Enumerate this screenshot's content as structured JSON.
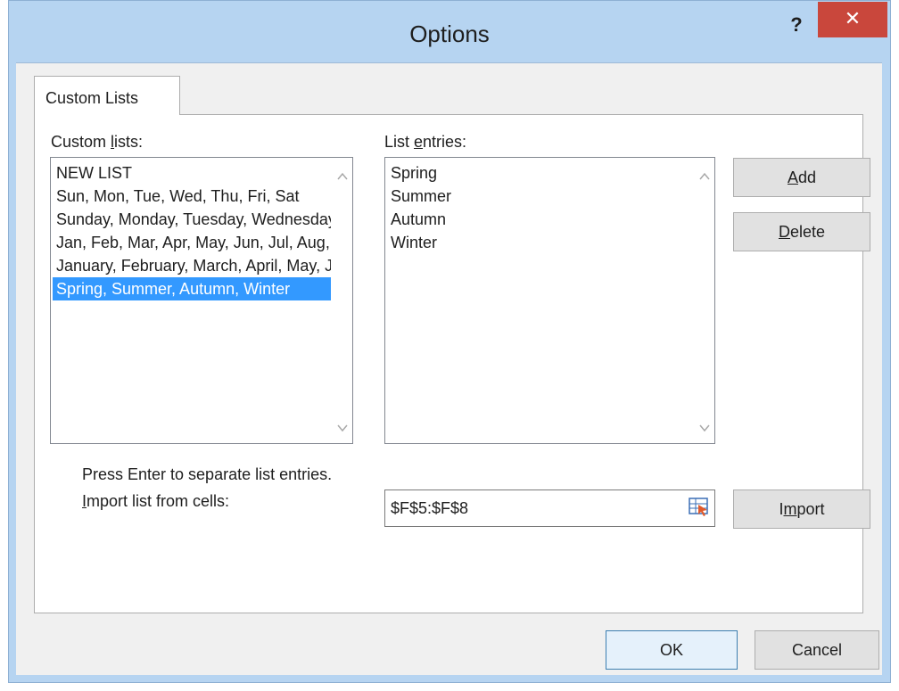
{
  "window": {
    "title": "Options",
    "help_label": "?",
    "close_label": "✕"
  },
  "tabs": [
    {
      "label": "Custom Lists"
    }
  ],
  "custom_lists": {
    "label_pre": "Custom ",
    "label_key": "l",
    "label_post": "ists:",
    "items": [
      "NEW LIST",
      "Sun, Mon, Tue, Wed, Thu, Fri, Sat",
      "Sunday, Monday, Tuesday, Wednesday, Thursday, Friday, Saturday",
      "Jan, Feb, Mar, Apr, May, Jun, Jul, Aug, Sep, Oct, Nov, Dec",
      "January, February, March, April, May, June, July, August, September, October, November, December",
      "Spring, Summer, Autumn, Winter"
    ],
    "selected_index": 5
  },
  "list_entries": {
    "label_pre": "List ",
    "label_key": "e",
    "label_post": "ntries:",
    "items": [
      "Spring",
      "Summer",
      "Autumn",
      "Winter"
    ]
  },
  "buttons": {
    "add_key": "A",
    "add_rest": "dd",
    "delete_key": "D",
    "delete_rest": "elete",
    "import_pre": "I",
    "import_key": "m",
    "import_post": "port",
    "ok": "OK",
    "cancel": "Cancel"
  },
  "hint": "Press Enter to separate list entries.",
  "import_from": {
    "label_key": "I",
    "label_rest": "mport list from cells:",
    "value": "$F$5:$F$8"
  },
  "colors": {
    "selection": "#3399ff",
    "close": "#c9473c",
    "frame": "#b6d4f1"
  },
  "icons": {
    "collapse_dialog": "collapse-dialog-icon",
    "scroll_up": "chevron-up-icon",
    "scroll_down": "chevron-down-icon"
  }
}
